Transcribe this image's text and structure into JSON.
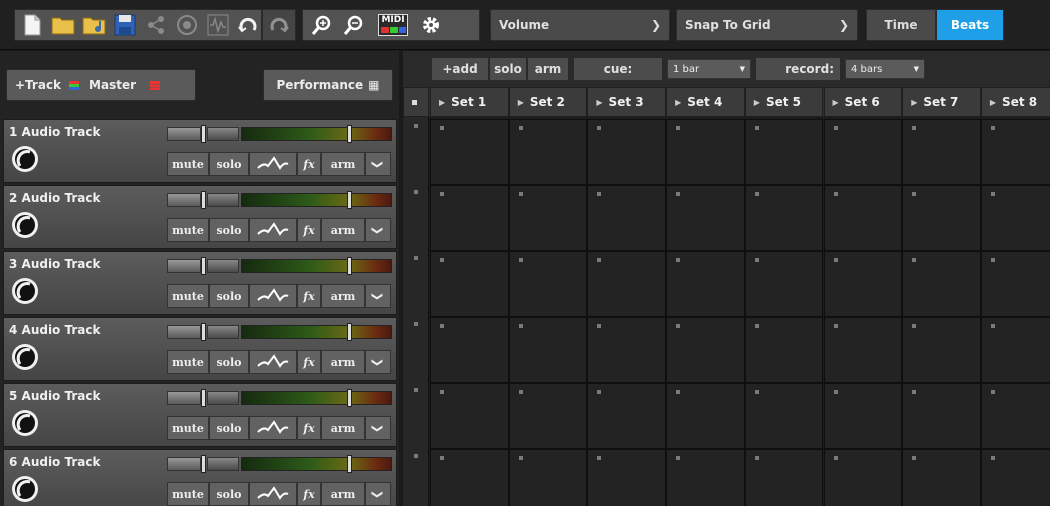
{
  "toolbar": {
    "icons": [
      "new-file-icon",
      "open-folder-icon",
      "open-audio-folder-icon",
      "save-icon",
      "share-icon",
      "settings-dial-icon",
      "audio-waveform-icon",
      "undo-icon",
      "redo-icon",
      "zoom-in-icon",
      "zoom-out-icon",
      "midi-icon",
      "gear-icon"
    ],
    "midi_label": "MIDI",
    "dropdown1": "Volume",
    "dropdown2": "Snap To Grid",
    "time_label": "Time",
    "beats_label": "Beats",
    "active_mode": "Beats",
    "accent": "#1e9fe8"
  },
  "left": {
    "track_label": "+Track",
    "master_label": "Master",
    "performance_label": "Performance"
  },
  "tracks": [
    {
      "name": "1 Audio Track"
    },
    {
      "name": "2 Audio Track"
    },
    {
      "name": "3 Audio Track"
    },
    {
      "name": "4 Audio Track"
    },
    {
      "name": "5 Audio Track"
    },
    {
      "name": "6 Audio Track"
    }
  ],
  "track_controls": {
    "mute": "mute",
    "solo": "solo",
    "fx": "fx",
    "arm": "arm"
  },
  "grid": {
    "add_label": "+add",
    "solo_label": "solo",
    "arm_label": "arm",
    "cue_label": "cue:",
    "cue_value": "1 bar",
    "record_label": "record:",
    "record_value": "4 bars",
    "sets": [
      "Set 1",
      "Set 2",
      "Set 3",
      "Set 4",
      "Set 5",
      "Set 6",
      "Set 7",
      "Set 8"
    ]
  }
}
